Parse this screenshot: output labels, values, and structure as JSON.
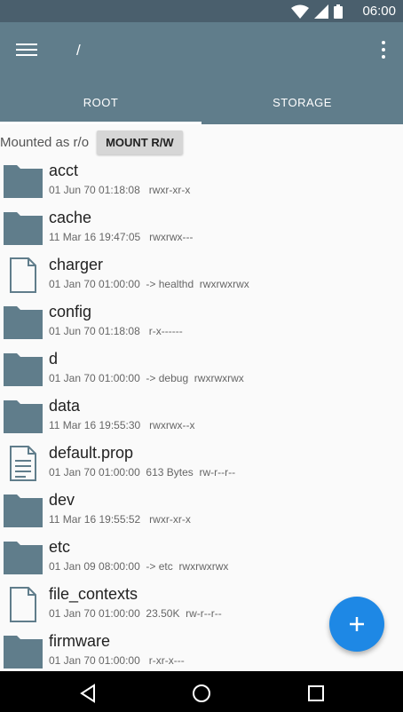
{
  "status_bar": {
    "time": "06:00",
    "icons": [
      "wifi-icon",
      "signal-icon",
      "battery-icon"
    ]
  },
  "app_bar": {
    "path": "/",
    "menu_icon": "hamburger-menu-icon",
    "overflow_icon": "more-vert-icon",
    "background": "#607d8b",
    "tabs": [
      {
        "label": "ROOT",
        "active": true
      },
      {
        "label": "STORAGE",
        "active": false
      }
    ]
  },
  "mount": {
    "status": "Mounted as r/o",
    "button_label": "MOUNT R/W"
  },
  "files": [
    {
      "name": "acct",
      "type": "folder",
      "meta": "01 Jun 70 01:18:08   rwxr-xr-x"
    },
    {
      "name": "cache",
      "type": "folder",
      "meta": "11 Mar 16 19:47:05   rwxrwx---"
    },
    {
      "name": "charger",
      "type": "file",
      "meta": "01 Jan 70 01:00:00  -> healthd  rwxrwxrwx"
    },
    {
      "name": "config",
      "type": "folder",
      "meta": "01 Jun 70 01:18:08   r-x------"
    },
    {
      "name": "d",
      "type": "folder",
      "meta": "01 Jan 70 01:00:00  -> debug  rwxrwxrwx"
    },
    {
      "name": "data",
      "type": "folder",
      "meta": "11 Mar 16 19:55:30   rwxrwx--x"
    },
    {
      "name": "default.prop",
      "type": "text-file",
      "meta": "01 Jan 70 01:00:00  613 Bytes  rw-r--r--"
    },
    {
      "name": "dev",
      "type": "folder",
      "meta": "11 Mar 16 19:55:52   rwxr-xr-x"
    },
    {
      "name": "etc",
      "type": "folder",
      "meta": "01 Jan 09 08:00:00  -> etc  rwxrwxrwx"
    },
    {
      "name": "file_contexts",
      "type": "file",
      "meta": "01 Jan 70 01:00:00  23.50K  rw-r--r--"
    },
    {
      "name": "firmware",
      "type": "folder",
      "meta": "01 Jan 70 01:00:00   r-xr-x---"
    }
  ],
  "fab": {
    "label": "+",
    "icon": "add-icon",
    "color": "#1e88e5"
  },
  "nav_bar": {
    "icons": [
      "back-icon",
      "home-icon",
      "recents-icon"
    ]
  },
  "colors": {
    "folder": "#607d8b",
    "status_bar": "#4a5f6d"
  }
}
